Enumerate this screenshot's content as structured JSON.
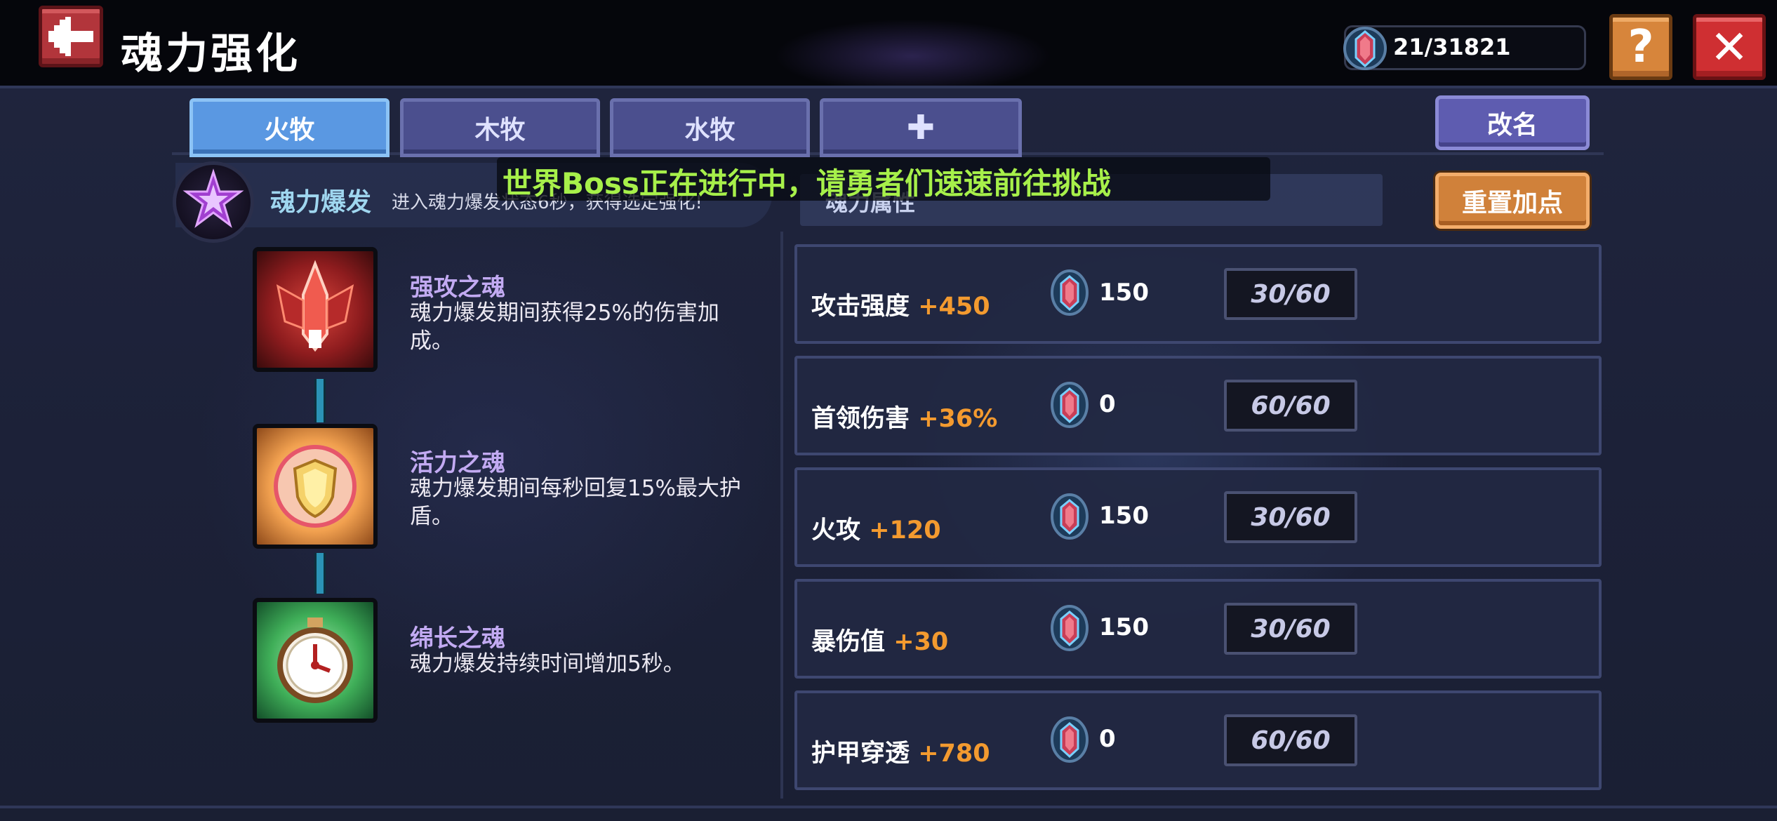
{
  "header": {
    "title": "魂力强化",
    "currency": "21/31821",
    "help_label": "?",
    "close_label": "✕"
  },
  "tabs": [
    {
      "label": "火牧",
      "active": true
    },
    {
      "label": "木牧",
      "active": false
    },
    {
      "label": "水牧",
      "active": false
    },
    {
      "label": "✚",
      "active": false
    }
  ],
  "buttons": {
    "rename": "改名",
    "reset": "重置加点"
  },
  "burst": {
    "label": "魂力爆发",
    "description": "进入魂力爆发状态6秒，获得选定强化!"
  },
  "ticker": "世界Boss正在进行中，请勇者们速速前往挑战",
  "attributes_header": "魂力属性",
  "souls": [
    {
      "name": "强攻之魂",
      "description": "魂力爆发期间获得25%的伤害加成。",
      "icon": "attack-soul-icon"
    },
    {
      "name": "活力之魂",
      "description": "魂力爆发期间每秒回复15%最大护盾。",
      "icon": "vitality-soul-icon"
    },
    {
      "name": "绵长之魂",
      "description": "魂力爆发持续时间增加5秒。",
      "icon": "duration-soul-icon"
    }
  ],
  "attributes": [
    {
      "name": "攻击强度",
      "bonus": "+450",
      "cost": "150",
      "level": "30/60"
    },
    {
      "name": "首领伤害",
      "bonus": "+36%",
      "cost": "0",
      "level": "60/60"
    },
    {
      "name": "火攻",
      "bonus": "+120",
      "cost": "150",
      "level": "30/60"
    },
    {
      "name": "暴伤值",
      "bonus": "+30",
      "cost": "150",
      "level": "30/60"
    },
    {
      "name": "护甲穿透",
      "bonus": "+780",
      "cost": "0",
      "level": "60/60"
    }
  ],
  "colors": {
    "background": "#1b2036",
    "tab_active": "#5a98e2",
    "tab_inactive": "#4b4f8e",
    "bonus_orange": "#f39a2f",
    "ticker_green": "#a7f04a",
    "soul_name_purple": "#c2aaf2",
    "close_red": "#cf2f32",
    "help_orange": "#d7853b"
  }
}
